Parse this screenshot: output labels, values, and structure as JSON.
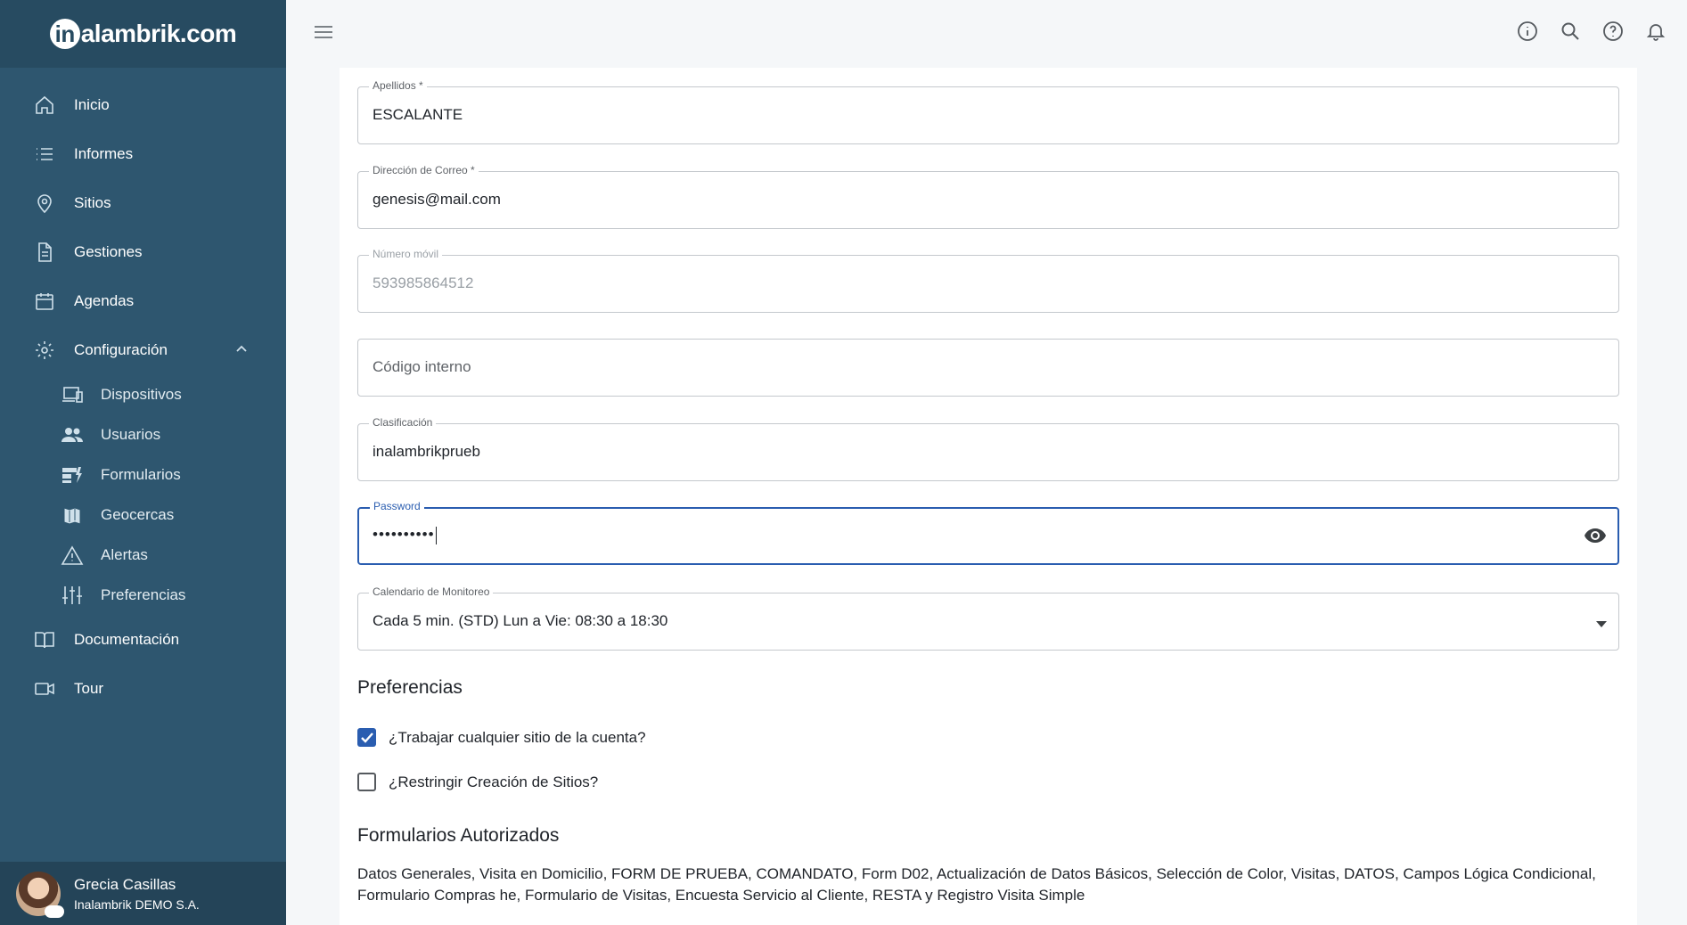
{
  "app": {
    "logo_text": "alambrik.com",
    "logo_prefix": "in"
  },
  "sidebar": {
    "items": [
      {
        "label": "Inicio",
        "icon": "home-icon"
      },
      {
        "label": "Informes",
        "icon": "list-icon"
      },
      {
        "label": "Sitios",
        "icon": "location-pin-icon"
      },
      {
        "label": "Gestiones",
        "icon": "document-icon"
      },
      {
        "label": "Agendas",
        "icon": "calendar-icon"
      },
      {
        "label": "Configuración",
        "icon": "gear-icon"
      }
    ],
    "sub_items": [
      {
        "label": "Dispositivos",
        "icon": "devices-icon"
      },
      {
        "label": "Usuarios",
        "icon": "users-icon"
      },
      {
        "label": "Formularios",
        "icon": "dynamic-form-icon"
      },
      {
        "label": "Geocercas",
        "icon": "map-icon"
      },
      {
        "label": "Alertas",
        "icon": "warning-icon"
      },
      {
        "label": "Preferencias",
        "icon": "sliders-icon"
      }
    ],
    "bottom_items": [
      {
        "label": "Documentación",
        "icon": "book-icon"
      },
      {
        "label": "Tour",
        "icon": "video-camera-icon"
      }
    ],
    "user": {
      "name": "Grecia Casillas",
      "org": "Inalambrik DEMO S.A."
    }
  },
  "form": {
    "apellidos": {
      "label": "Apellidos *",
      "value": "ESCALANTE"
    },
    "correo": {
      "label": "Dirección de Correo *",
      "value": "genesis@mail.com"
    },
    "movil": {
      "label": "Número móvil",
      "value": "593985864512"
    },
    "codigo": {
      "placeholder": "Código interno"
    },
    "clasificacion": {
      "label": "Clasificación",
      "value": "inalambrikprueb"
    },
    "password": {
      "label": "Password",
      "value": "••••••••••"
    },
    "calendario": {
      "label": "Calendario de Monitoreo",
      "value": "Cada 5 min. (STD) Lun a Vie: 08:30 a 18:30"
    }
  },
  "preferences": {
    "title": "Preferencias",
    "options": [
      {
        "label": "¿Trabajar cualquier sitio de la cuenta?",
        "checked": true
      },
      {
        "label": "¿Restringir Creación de Sitios?",
        "checked": false
      }
    ]
  },
  "authorized_forms": {
    "title": "Formularios Autorizados",
    "text": "Datos Generales, Visita en Domicilio, FORM DE PRUEBA, COMANDATO, Form D02, Actualización de Datos Básicos, Selección de Color, Visitas, DATOS, Campos Lógica Condicional, Formulario Compras he, Formulario de Visitas, Encuesta Servicio al Cliente, RESTA y Registro Visita Simple"
  },
  "colors": {
    "sidebar": "#2e566f",
    "accent": "#2a5db0"
  }
}
